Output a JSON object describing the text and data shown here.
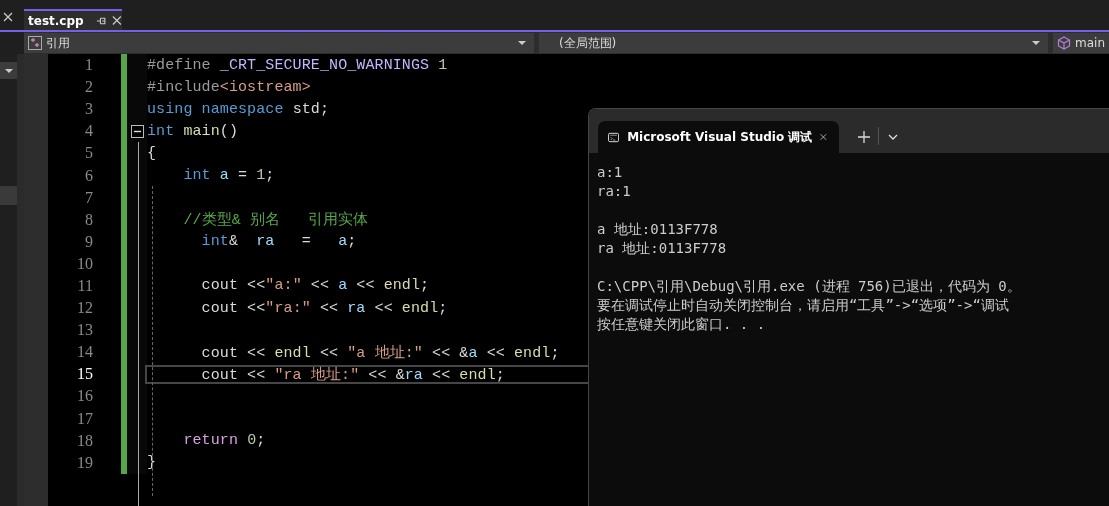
{
  "tab": {
    "title": "test.cpp"
  },
  "nav": {
    "project": "引用",
    "scope": "(全局范围)",
    "member": "main"
  },
  "code": {
    "lines": [
      {
        "number": "1",
        "current": false,
        "collapsible": false,
        "tokens": [
          {
            "text": "#define ",
            "kind": "pre"
          },
          {
            "text": "_CRT_SECURE_NO_WARNINGS",
            "kind": "macro"
          },
          {
            "text": " 1",
            "kind": "num"
          }
        ]
      },
      {
        "number": "2",
        "current": false,
        "collapsible": false,
        "tokens": [
          {
            "text": "#include",
            "kind": "pre"
          },
          {
            "text": "<iostream>",
            "kind": "str"
          }
        ]
      },
      {
        "number": "3",
        "current": false,
        "collapsible": false,
        "tokens": [
          {
            "text": "using namespace",
            "kind": "kw"
          },
          {
            "text": " std;",
            "kind": "plain"
          }
        ]
      },
      {
        "number": "4",
        "current": false,
        "collapsible": true,
        "tokens": [
          {
            "text": "int ",
            "kind": "kw"
          },
          {
            "text": "main",
            "kind": "fn"
          },
          {
            "text": "()",
            "kind": "plain"
          }
        ]
      },
      {
        "number": "5",
        "current": false,
        "collapsible": false,
        "tokens": [
          {
            "text": "{",
            "kind": "plain"
          }
        ]
      },
      {
        "number": "6",
        "current": false,
        "collapsible": false,
        "tokens": [
          {
            "text": "    int ",
            "kind": "kw"
          },
          {
            "text": "a",
            "kind": "var"
          },
          {
            "text": " = ",
            "kind": "plain"
          },
          {
            "text": "1",
            "kind": "num"
          },
          {
            "text": ";",
            "kind": "plain"
          }
        ]
      },
      {
        "number": "7",
        "current": false,
        "collapsible": false
      },
      {
        "number": "8",
        "current": false,
        "collapsible": false,
        "tokens": [
          {
            "text": "    //类型& 别名   引用实体",
            "kind": "comment"
          }
        ]
      },
      {
        "number": "9",
        "current": false,
        "collapsible": false,
        "tokens": [
          {
            "text": "      int",
            "kind": "kw"
          },
          {
            "text": "&  ",
            "kind": "plain"
          },
          {
            "text": "ra",
            "kind": "var"
          },
          {
            "text": "   =   ",
            "kind": "plain"
          },
          {
            "text": "a",
            "kind": "var"
          },
          {
            "text": ";",
            "kind": "plain"
          }
        ]
      },
      {
        "number": "10",
        "current": false,
        "collapsible": false
      },
      {
        "number": "11",
        "current": false,
        "collapsible": false,
        "tokens": [
          {
            "text": "      cout <<",
            "kind": "plain"
          },
          {
            "text": "\"a:\"",
            "kind": "str"
          },
          {
            "text": " << ",
            "kind": "plain"
          },
          {
            "text": "a",
            "kind": "var"
          },
          {
            "text": " << ",
            "kind": "plain"
          },
          {
            "text": "endl",
            "kind": "fn"
          },
          {
            "text": ";",
            "kind": "plain"
          }
        ]
      },
      {
        "number": "12",
        "current": false,
        "collapsible": false,
        "tokens": [
          {
            "text": "      cout <<",
            "kind": "plain"
          },
          {
            "text": "\"ra:\"",
            "kind": "str"
          },
          {
            "text": " << ",
            "kind": "plain"
          },
          {
            "text": "ra",
            "kind": "var"
          },
          {
            "text": " << ",
            "kind": "plain"
          },
          {
            "text": "endl",
            "kind": "fn"
          },
          {
            "text": ";",
            "kind": "plain"
          }
        ]
      },
      {
        "number": "13",
        "current": false,
        "collapsible": false
      },
      {
        "number": "14",
        "current": false,
        "collapsible": false,
        "tokens": [
          {
            "text": "      cout << ",
            "kind": "plain"
          },
          {
            "text": "endl",
            "kind": "fn"
          },
          {
            "text": " << ",
            "kind": "plain"
          },
          {
            "text": "\"a 地址:\"",
            "kind": "str"
          },
          {
            "text": " << &",
            "kind": "plain"
          },
          {
            "text": "a",
            "kind": "var"
          },
          {
            "text": " << ",
            "kind": "plain"
          },
          {
            "text": "endl",
            "kind": "fn"
          },
          {
            "text": ";",
            "kind": "plain"
          }
        ]
      },
      {
        "number": "15",
        "current": true,
        "collapsible": false,
        "tokens": [
          {
            "text": "      cout << ",
            "kind": "plain"
          },
          {
            "text": "\"ra 地址:\"",
            "kind": "str"
          },
          {
            "text": " << &",
            "kind": "plain"
          },
          {
            "text": "ra",
            "kind": "var"
          },
          {
            "text": " << ",
            "kind": "plain"
          },
          {
            "text": "endl",
            "kind": "fn"
          },
          {
            "text": ";",
            "kind": "plain"
          }
        ]
      },
      {
        "number": "16",
        "current": false,
        "collapsible": false
      },
      {
        "number": "17",
        "current": false,
        "collapsible": false
      },
      {
        "number": "18",
        "current": false,
        "collapsible": false,
        "tokens": [
          {
            "text": "    return ",
            "kind": "ctl"
          },
          {
            "text": "0",
            "kind": "num"
          },
          {
            "text": ";",
            "kind": "plain"
          }
        ]
      },
      {
        "number": "19",
        "current": false,
        "collapsible": false,
        "tokens": [
          {
            "text": "}",
            "kind": "plain"
          }
        ]
      }
    ]
  },
  "console": {
    "title": "Microsoft Visual Studio 调试",
    "blocks": [
      [
        "a:1",
        "ra:1"
      ],
      [
        "a 地址:0113F778",
        "ra 地址:0113F778"
      ],
      [
        "C:\\CPP\\引用\\Debug\\引用.exe (进程 756)已退出，代码为 0。",
        "要在调试停止时自动关闭控制台，请启用“工具”->“选项”->“调试",
        "按任意键关闭此窗口. . ."
      ]
    ]
  }
}
